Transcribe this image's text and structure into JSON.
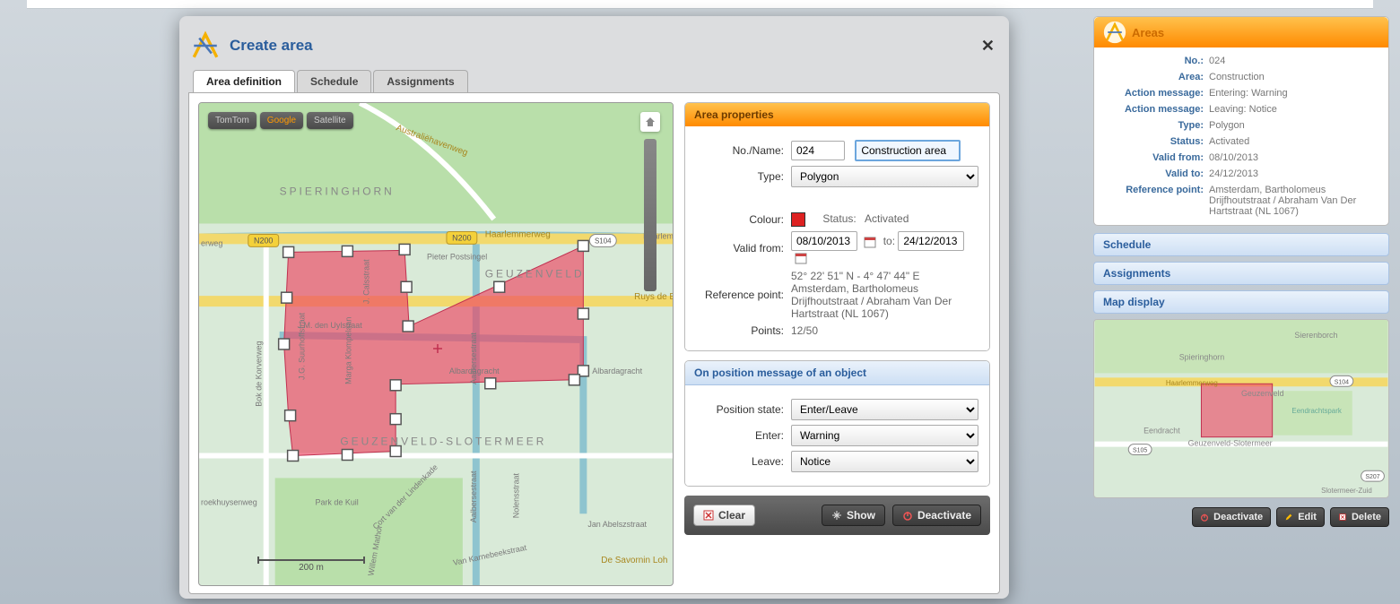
{
  "modal": {
    "title": "Create area",
    "tabs": {
      "area_def": "Area definition",
      "schedule": "Schedule",
      "assignments": "Assignments"
    }
  },
  "map_buttons": {
    "tomtom": "TomTom",
    "google": "Google",
    "satellite": "Satellite"
  },
  "map": {
    "labels": {
      "spieringhorn": "SPIERINGHORN",
      "geuzenveld": "GEUZENVELD",
      "geuzenveld_slotermeer": "GEUZENVELD-SLOTERMEER",
      "haarlemmerweg": "Haarlemmerweg",
      "ruys_de": "Ruys de B",
      "australie": "Australiëhavenweg",
      "pieter": "Pieter Postsingel",
      "uylstraat": "J.M. den Uylstraat",
      "suurhoff": "J.G. Suurhoffstraat",
      "calsstraat": "J. Calsstraat",
      "marga": "Marga Klompelaan",
      "aalberse": "Aalbersestraat",
      "albarda": "Albardagracht",
      "albarda2": "Albardagracht",
      "bok": "Bok de Korverweg",
      "kuil": "Park de Kuil",
      "cort": "Cort van der Lindenkade",
      "nolens": "Nolensstraat",
      "karnebeek": "Van Karnebeekstraat",
      "willem": "Willem Mathor",
      "abels": "Jan Abelszstraat",
      "savornin": "De Savornin Loh",
      "roekhuysen": "roekhuysenweg",
      "erweg": "erweg",
      "haarlen": "Haarlem",
      "scale": "200 m",
      "shield_n200": "N200",
      "shield_s104": "S104"
    }
  },
  "props": {
    "panel_title": "Area properties",
    "labels": {
      "no_name": "No./Name:",
      "type": "Type:",
      "colour": "Colour:",
      "status_lbl": "Status:",
      "valid_from": "Valid from:",
      "to": "to:",
      "ref_point": "Reference point:",
      "points": "Points:"
    },
    "no": "024",
    "name": "Construction area",
    "type": "Polygon",
    "status": "Activated",
    "valid_from": "08/10/2013",
    "valid_to": "24/12/2013",
    "ref1": "52° 22' 51\" N - 4° 47' 44\" E",
    "ref2": "Amsterdam, Bartholomeus Drijfhoutstraat / Abraham Van Der Hartstraat (NL 1067)",
    "points": "12/50"
  },
  "position_msg": {
    "panel_title": "On position message of an object",
    "labels": {
      "position_state": "Position state:",
      "enter": "Enter:",
      "leave": "Leave:"
    },
    "position_state": "Enter/Leave",
    "enter": "Warning",
    "leave": "Notice"
  },
  "actions": {
    "clear": "Clear",
    "show": "Show",
    "deactivate": "Deactivate"
  },
  "sidebar": {
    "areas_title": "Areas",
    "kv": {
      "no_lbl": "No.:",
      "no": "024",
      "area_lbl": "Area:",
      "area": "Construction",
      "am1_lbl": "Action message:",
      "am1": "Entering: Warning",
      "am2_lbl": "Action message:",
      "am2": "Leaving: Notice",
      "type_lbl": "Type:",
      "type": "Polygon",
      "status_lbl": "Status:",
      "status": "Activated",
      "vfrom_lbl": "Valid from:",
      "vfrom": "08/10/2013",
      "vto_lbl": "Valid to:",
      "vto": "24/12/2013",
      "ref_lbl": "Reference point:",
      "ref": "Amsterdam, Bartholomeus Drijfhoutstraat / Abraham Van Der Hartstraat (NL 1067)"
    },
    "schedule": "Schedule",
    "assignments": "Assignments",
    "map_display": "Map display",
    "mini_labels": {
      "spieringhorn": "Spieringhorn",
      "geuzenveld": "Geuzenveld",
      "gslotermeer": "Geuzenveld-Slotermeer",
      "eendracht": "Eendracht",
      "eendrachtspark": "Eendrachtspark",
      "haarlemmerweg": "Haarlemmerweg",
      "sierenborch": "Sierenborch",
      "slotermeer": "Slotermeer-Zuid",
      "s104": "S104",
      "s105": "S105",
      "s207": "S207"
    },
    "buttons": {
      "deactivate": "Deactivate",
      "edit": "Edit",
      "delete": "Delete"
    }
  }
}
